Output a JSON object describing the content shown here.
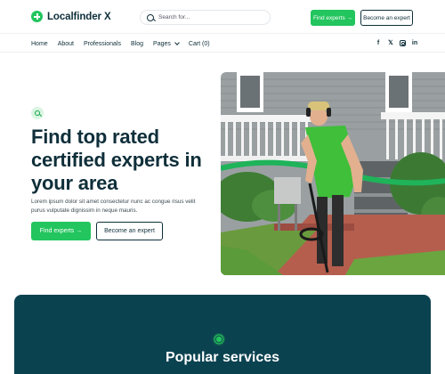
{
  "brand": {
    "name": "Localfinder X"
  },
  "search": {
    "placeholder": "Search for..."
  },
  "header": {
    "find_experts_label": "Find experts →",
    "become_expert_label": "Become an expert"
  },
  "nav": {
    "items": [
      {
        "label": "Home"
      },
      {
        "label": "About"
      },
      {
        "label": "Professionals"
      },
      {
        "label": "Blog"
      },
      {
        "label": "Pages"
      },
      {
        "label": "Cart (0)"
      }
    ]
  },
  "social": {
    "facebook": "f",
    "twitter": "𝕏",
    "linkedin": "in"
  },
  "hero": {
    "title": "Find top rated certified experts in your area",
    "description": "Lorem ipsum dolor sit amet consectetur nunc ac congue risus velit purus vulputate dignissim in neque mauris.",
    "find_experts_label": "Find experts →",
    "become_expert_label": "Become an expert"
  },
  "services": {
    "title": "Popular services"
  },
  "colors": {
    "accent": "#22c55e",
    "dark": "#0f2f3a",
    "panel": "#0b4250"
  },
  "icons": [
    "search-icon",
    "facebook-icon",
    "twitter-icon",
    "instagram-icon",
    "linkedin-icon",
    "magnifier-badge-icon",
    "gear-badge-icon"
  ]
}
